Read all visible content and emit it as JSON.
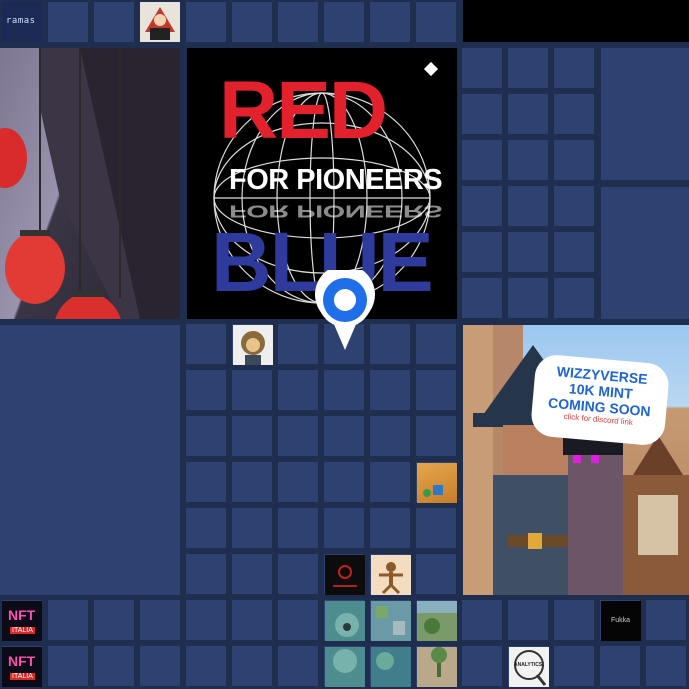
{
  "ads": {
    "red_blue": {
      "line1": "RED",
      "line2": "FOR PIONEERS",
      "line3": "BLUE",
      "reflection": "FOR PIONEERS"
    },
    "wizzyverse": {
      "title_lines": [
        "WIZZYVERSE",
        "10K MINT",
        "COMING SOON"
      ],
      "subtitle": "click for discord link"
    }
  },
  "tiles": {
    "ramas": "ramas",
    "nft_italia_1": {
      "top": "NFT",
      "bottom": "ITALIA"
    },
    "nft_italia_2": {
      "top": "NFT",
      "bottom": "ITALIA"
    },
    "fukka": "Fukka",
    "analytics": "ANALYTICS"
  },
  "colors": {
    "page_bg": "#1f2d4f",
    "empty_cell": "#2e4272",
    "pin_blue": "#1e6fe8",
    "ad_red": "#e3212d",
    "ad_blue": "#2e3a9c"
  }
}
